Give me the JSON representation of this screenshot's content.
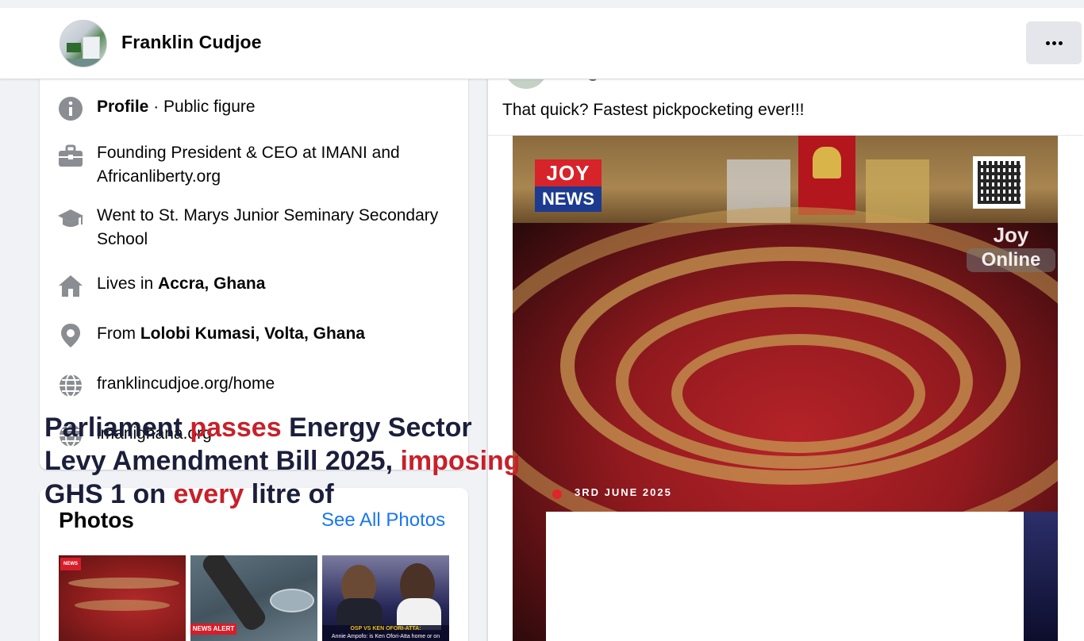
{
  "header": {
    "page_name": "Franklin Cudjoe"
  },
  "intro": {
    "profile": {
      "bold": "Profile",
      "rest": " · Public figure"
    },
    "work": "Founding President & CEO at IMANI and Africanliberty.org",
    "education": "Went to St. Marys Junior Seminary Secondary School",
    "lives": {
      "prefix": "Lives in ",
      "place": "Accra, Ghana"
    },
    "from": {
      "prefix": "From ",
      "place": "Lolobi Kumasi, Volta, Ghana"
    },
    "website1": "franklincudjoe.org/home",
    "website2": "imanighana.org"
  },
  "photos": {
    "title": "Photos",
    "see_all": "See All Photos",
    "thumbs": [
      {
        "badge": "NEWS"
      },
      {
        "tag": "NEWS ALERT"
      },
      {
        "caption_a": "OSP VS KEN OFORI-ATTA:",
        "caption_b": "Annie Ampofo: is Ken Ofori-Atta home or on admission at the hospital"
      }
    ]
  },
  "post": {
    "text": "That quick? Fastest pickpocketing ever!!!",
    "image": {
      "logo_top": "JOY",
      "logo_bottom": "NEWS",
      "watermark_top": "Joy",
      "watermark_bottom": "Online",
      "date": "3RD JUNE 2025",
      "headline_a": "Parliament ",
      "headline_b": "passes",
      "headline_c": " Energy Sector Levy Amendment Bill 2025, ",
      "headline_d": "imposing",
      "headline_e": " GHS 1 on ",
      "headline_f": "every",
      "headline_g": " litre of"
    }
  },
  "colors": {
    "link": "#1877f2",
    "icon_gray": "#8a8d91",
    "brand_red": "#d7232a",
    "brand_blue": "#1c3a8f"
  },
  "icons": [
    "info-icon",
    "briefcase-icon",
    "graduation-cap-icon",
    "home-icon",
    "location-pin-icon",
    "globe-icon",
    "more-dots-icon"
  ]
}
